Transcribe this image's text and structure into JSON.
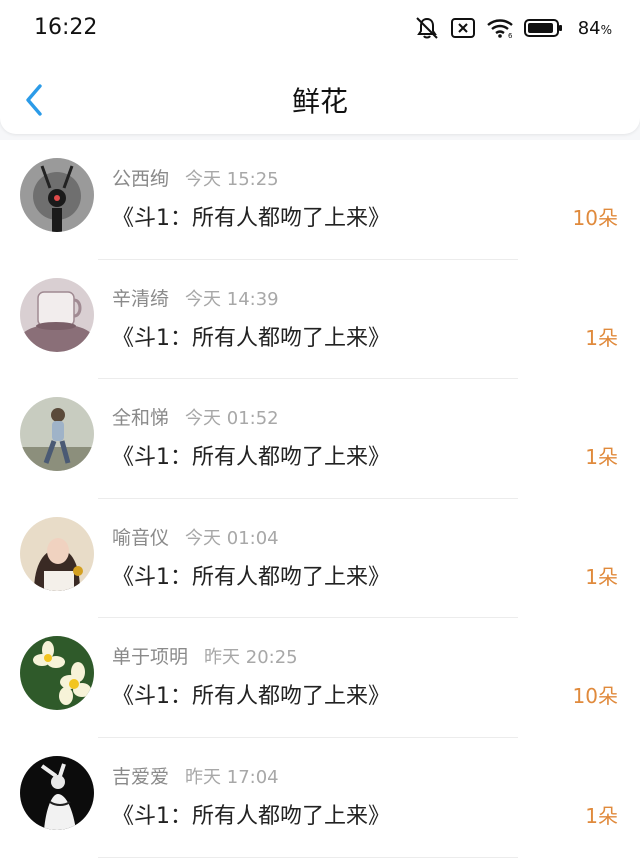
{
  "status_bar": {
    "time": "16:22",
    "battery_percent": "84",
    "battery_unit": "%",
    "icons": [
      "mute-bell-icon",
      "sim-blocked-icon",
      "wifi-icon",
      "battery-icon"
    ]
  },
  "nav": {
    "title": "鲜花",
    "back_icon": "chevron-left-icon",
    "accent": "#2b9be8"
  },
  "colors": {
    "count": "#e08a3c",
    "name": "#8a8a8a",
    "time": "#a8a8a8"
  },
  "items": [
    {
      "name": "公西绚",
      "time": "今天 15:25",
      "book": "《斗1：所有人都吻了上来》",
      "count": "10朵",
      "avatar": "dark-figure"
    },
    {
      "name": "辛清绮",
      "time": "今天 14:39",
      "book": "《斗1：所有人都吻了上来》",
      "count": "1朵",
      "avatar": "cup"
    },
    {
      "name": "全和悌",
      "time": "今天 01:52",
      "book": "《斗1：所有人都吻了上来》",
      "count": "1朵",
      "avatar": "girl-sitting"
    },
    {
      "name": "喻音仪",
      "time": "今天 01:04",
      "book": "《斗1：所有人都吻了上来》",
      "count": "1朵",
      "avatar": "woman-portrait"
    },
    {
      "name": "单于项明",
      "time": "昨天 20:25",
      "book": "《斗1：所有人都吻了上来》",
      "count": "10朵",
      "avatar": "flowers"
    },
    {
      "name": "吉爱爱",
      "time": "昨天 17:04",
      "book": "《斗1：所有人都吻了上来》",
      "count": "1朵",
      "avatar": "bw-figure"
    }
  ]
}
